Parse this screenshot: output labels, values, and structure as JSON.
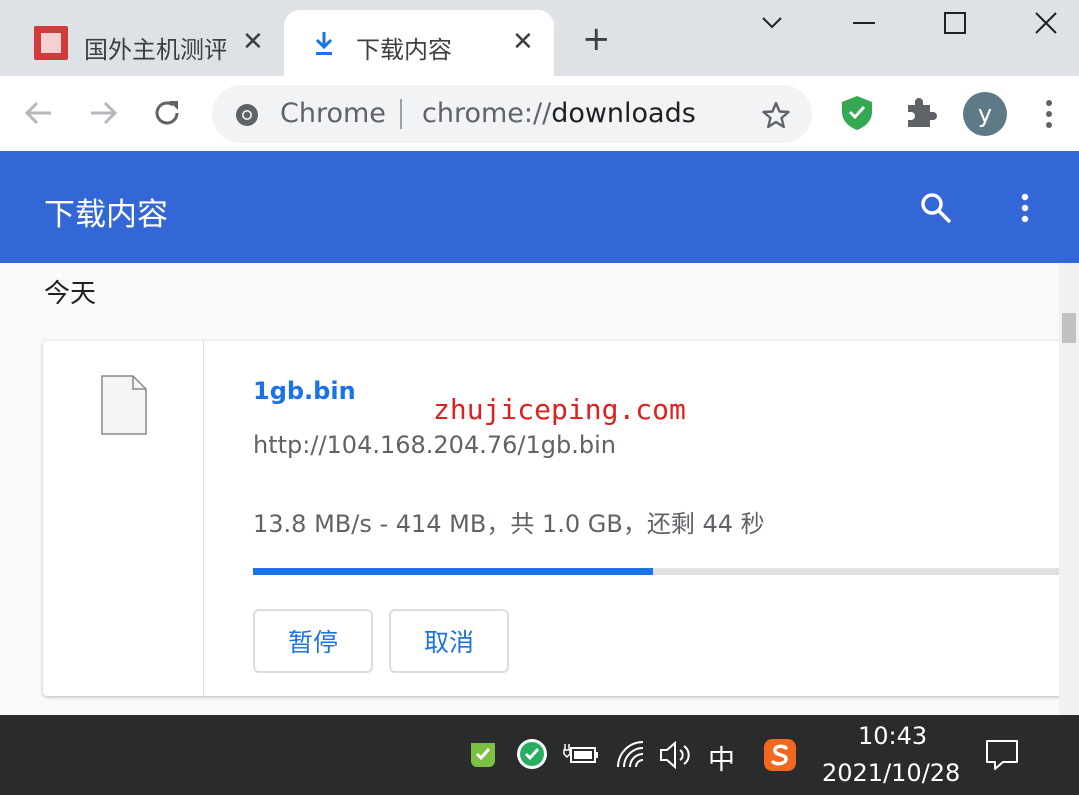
{
  "tabs": [
    {
      "title": "国外主机测评",
      "close": "✕"
    },
    {
      "title": "下载内容",
      "close": "✕"
    }
  ],
  "new_tab": "+",
  "omnibox": {
    "site": "Chrome",
    "url_scheme": "chrome://",
    "url_path": "downloads"
  },
  "avatar_letter": "y",
  "header": {
    "title": "下载内容"
  },
  "date_label": "今天",
  "download": {
    "filename": "1gb.bin",
    "url": "http://104.168.204.76/1gb.bin",
    "status": "13.8 MB/s - 414 MB，共 1.0 GB，还剩 44 秒",
    "progress_fraction": 0.47,
    "pause_label": "暂停",
    "cancel_label": "取消"
  },
  "watermark": "zhujiceping.com",
  "taskbar": {
    "ime": "中",
    "time": "10:43",
    "date": "2021/10/28"
  },
  "colors": {
    "accent": "#3367d6",
    "link": "#1a73e8"
  }
}
